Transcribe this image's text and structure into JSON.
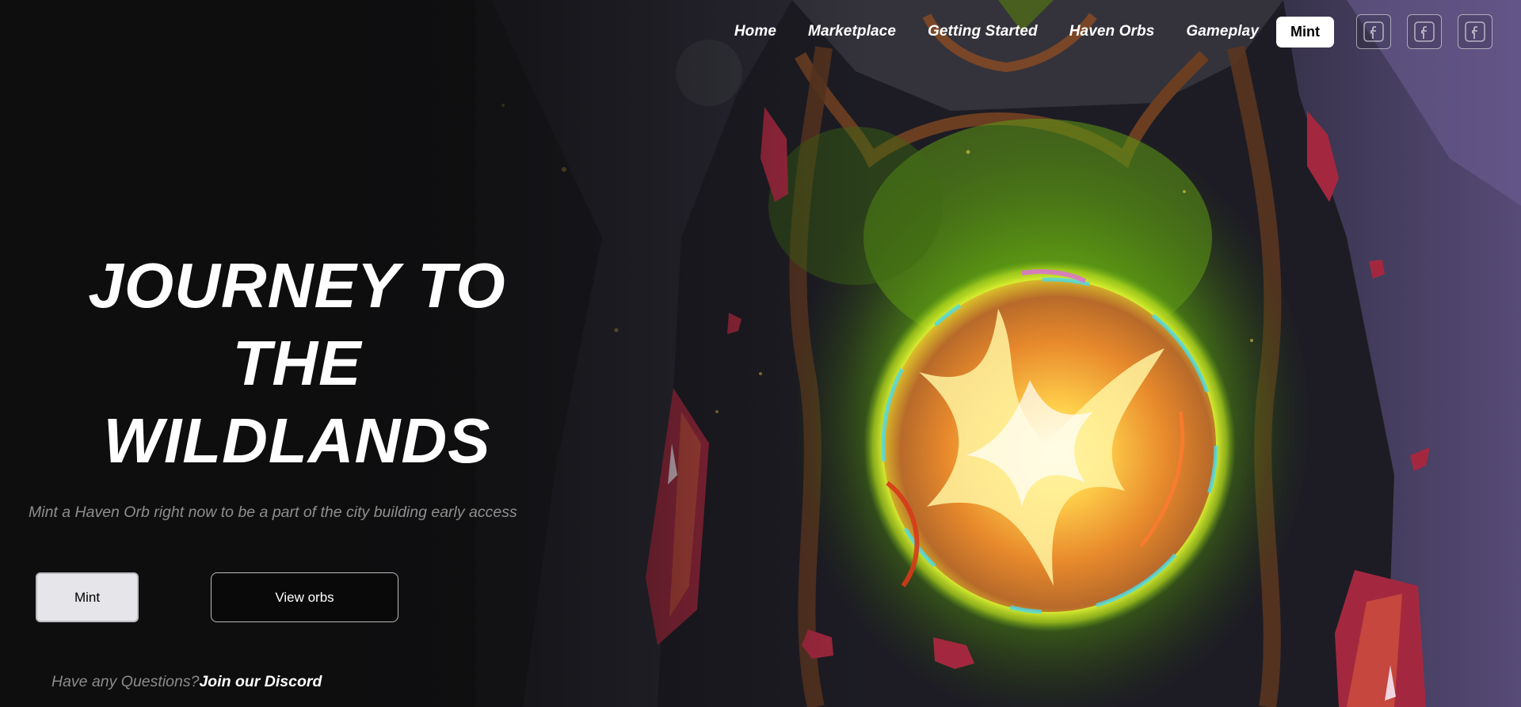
{
  "nav": {
    "links": [
      {
        "label": "Home"
      },
      {
        "label": "Marketplace"
      },
      {
        "label": "Getting Started"
      },
      {
        "label": "Haven Orbs"
      },
      {
        "label": "Gameplay"
      }
    ],
    "mint_label": "Mint",
    "social_icons": [
      "facebook-icon",
      "facebook-icon",
      "facebook-icon"
    ]
  },
  "hero": {
    "title_line1": "JOURNEY TO THE",
    "title_line2": "WILDLANDS",
    "subtitle": "Mint a Haven Orb right now to be a part of the city building early access",
    "mint_button": "Mint",
    "view_button": "View orbs"
  },
  "footer": {
    "question_text": "Have any Questions?",
    "discord_link": "Join our Discord"
  },
  "colors": {
    "background": "#111112",
    "nav_text": "#ffffff",
    "subtitle_text": "#8e8e8e",
    "mint_button_bg": "#e6e6ea",
    "orb_glow": "#f5c43a",
    "foliage": "#4e8a12",
    "crystal": "#a3283f"
  }
}
